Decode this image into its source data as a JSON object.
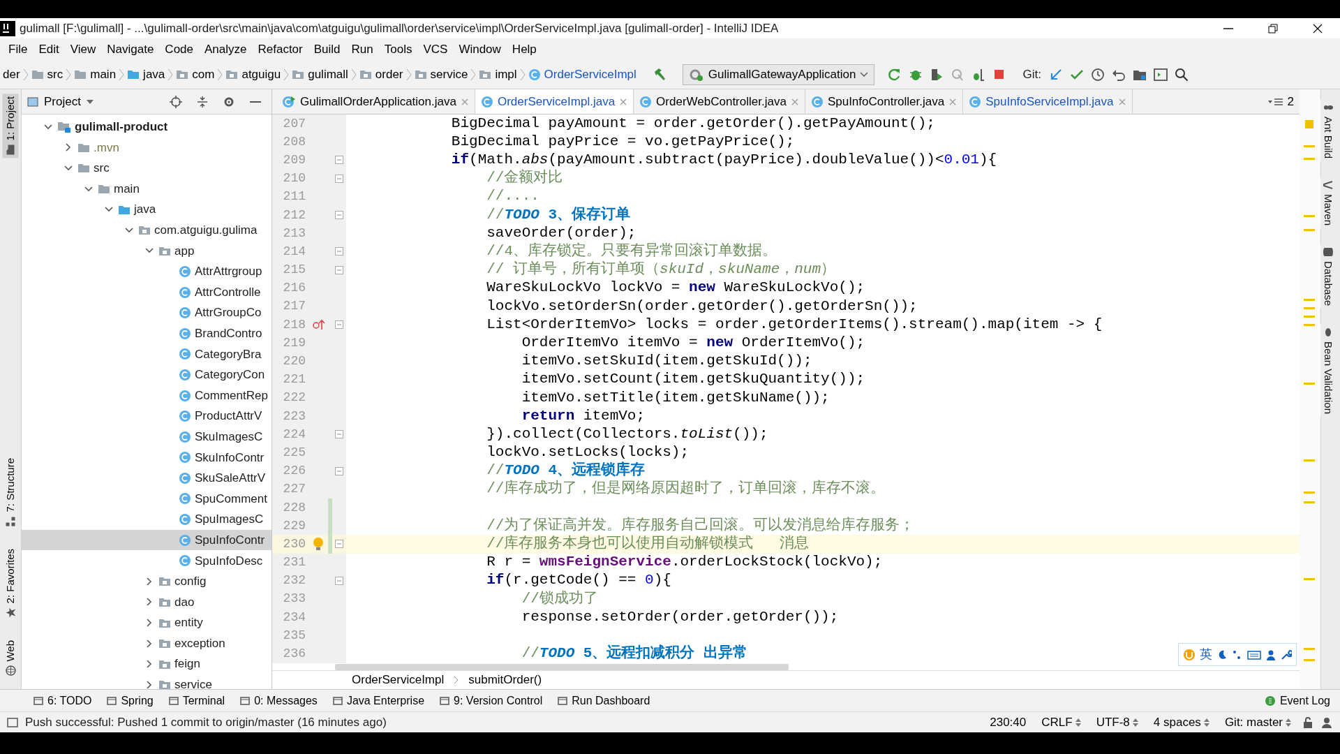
{
  "window": {
    "title": "gulimall [F:\\gulimall] - ...\\gulimall-order\\src\\main\\java\\com\\atguigu\\gulimall\\order\\service\\impl\\OrderServiceImpl.java [gulimall-order] - IntelliJ IDEA"
  },
  "menu": [
    "File",
    "Edit",
    "View",
    "Navigate",
    "Code",
    "Analyze",
    "Refactor",
    "Build",
    "Run",
    "Tools",
    "VCS",
    "Window",
    "Help"
  ],
  "nav_bar": {
    "crumbs": [
      {
        "label": "der",
        "kind": "text"
      },
      {
        "label": "src",
        "kind": "folder"
      },
      {
        "label": "main",
        "kind": "folder"
      },
      {
        "label": "java",
        "kind": "source"
      },
      {
        "label": "com",
        "kind": "package"
      },
      {
        "label": "atguigu",
        "kind": "package"
      },
      {
        "label": "gulimall",
        "kind": "package"
      },
      {
        "label": "order",
        "kind": "package"
      },
      {
        "label": "service",
        "kind": "package"
      },
      {
        "label": "impl",
        "kind": "package"
      },
      {
        "label": "OrderServiceImpl",
        "kind": "class"
      }
    ],
    "run_config": "GulimallGatewayApplication",
    "git_label": "Git:"
  },
  "left_strip": [
    "1: Project",
    "7: Structure",
    "2: Favorites",
    "Web"
  ],
  "project_panel": {
    "title": "Project",
    "tree": [
      {
        "label": "gulimall-product",
        "kind": "module",
        "expanded": true,
        "selected": false,
        "children": [
          {
            "label": ".mvn",
            "kind": "folder",
            "expanded": false,
            "selected": false
          },
          {
            "label": "src",
            "kind": "folder",
            "expanded": true,
            "selected": false,
            "children": [
              {
                "label": "main",
                "kind": "folder",
                "expanded": true,
                "selected": false,
                "children": [
                  {
                    "label": "java",
                    "kind": "source",
                    "expanded": true,
                    "selected": false,
                    "children": [
                      {
                        "label": "com.atguigu.gulima",
                        "kind": "package",
                        "expanded": true,
                        "selected": false,
                        "children": [
                          {
                            "label": "app",
                            "kind": "package",
                            "expanded": true,
                            "selected": false,
                            "children": [
                              {
                                "label": "AttrAttrgroup",
                                "kind": "class",
                                "selected": false
                              },
                              {
                                "label": "AttrControlle",
                                "kind": "class",
                                "selected": false
                              },
                              {
                                "label": "AttrGroupCo",
                                "kind": "class",
                                "selected": false
                              },
                              {
                                "label": "BrandContro",
                                "kind": "class",
                                "selected": false
                              },
                              {
                                "label": "CategoryBra",
                                "kind": "class",
                                "selected": false
                              },
                              {
                                "label": "CategoryCon",
                                "kind": "class",
                                "selected": false
                              },
                              {
                                "label": "CommentRep",
                                "kind": "class",
                                "selected": false
                              },
                              {
                                "label": "ProductAttrV",
                                "kind": "class",
                                "selected": false
                              },
                              {
                                "label": "SkuImagesC",
                                "kind": "class",
                                "selected": false
                              },
                              {
                                "label": "SkuInfoContr",
                                "kind": "class",
                                "selected": false
                              },
                              {
                                "label": "SkuSaleAttrV",
                                "kind": "class",
                                "selected": false
                              },
                              {
                                "label": "SpuComment",
                                "kind": "class",
                                "selected": false
                              },
                              {
                                "label": "SpuImagesC",
                                "kind": "class",
                                "selected": false
                              },
                              {
                                "label": "SpuInfoContr",
                                "kind": "class",
                                "selected": true
                              },
                              {
                                "label": "SpuInfoDesc",
                                "kind": "class",
                                "selected": false
                              }
                            ]
                          },
                          {
                            "label": "config",
                            "kind": "package",
                            "expanded": false,
                            "selected": false
                          },
                          {
                            "label": "dao",
                            "kind": "package",
                            "expanded": false,
                            "selected": false
                          },
                          {
                            "label": "entity",
                            "kind": "package",
                            "expanded": false,
                            "selected": false
                          },
                          {
                            "label": "exception",
                            "kind": "package",
                            "expanded": false,
                            "selected": false
                          },
                          {
                            "label": "feign",
                            "kind": "package",
                            "expanded": false,
                            "selected": false
                          },
                          {
                            "label": "service",
                            "kind": "package",
                            "expanded": false,
                            "selected": false
                          }
                        ]
                      }
                    ]
                  }
                ]
              }
            ]
          }
        ]
      }
    ]
  },
  "tabs": [
    {
      "label": "GulimallOrderApplication.java",
      "kind": "app",
      "selected": false,
      "modified": false
    },
    {
      "label": "OrderServiceImpl.java",
      "kind": "class",
      "selected": true,
      "modified": true
    },
    {
      "label": "OrderWebController.java",
      "kind": "class",
      "selected": false,
      "modified": false
    },
    {
      "label": "SpuInfoController.java",
      "kind": "class",
      "selected": false,
      "modified": false
    },
    {
      "label": "SpuInfoServiceImpl.java",
      "kind": "class",
      "selected": false,
      "modified": true
    }
  ],
  "tab_overflow": "2",
  "editor": {
    "lines": [
      {
        "number": "207",
        "fold": false,
        "changed": false,
        "current": false,
        "segments": [
          {
            "kind": "plain",
            "text": "        BigDecimal payAmount = order.getOrder().getPayAmount();"
          }
        ]
      },
      {
        "number": "208",
        "fold": false,
        "changed": false,
        "current": false,
        "segments": [
          {
            "kind": "plain",
            "text": "        BigDecimal payPrice = vo.getPayPrice();"
          }
        ]
      },
      {
        "number": "209",
        "fold": true,
        "changed": false,
        "current": false,
        "segments": [
          {
            "kind": "keyword",
            "text": "        if"
          },
          {
            "kind": "plain",
            "text": "(Math.*abs*(payAmount.subtract(payPrice).doubleValue())<"
          },
          {
            "kind": "number",
            "text": "0.01"
          },
          {
            "kind": "plain",
            "text": "){"
          }
        ]
      },
      {
        "number": "210",
        "fold": true,
        "changed": false,
        "current": false,
        "segments": [
          {
            "kind": "comment",
            "text": "            //金额对比"
          }
        ]
      },
      {
        "number": "211",
        "fold": false,
        "changed": false,
        "current": false,
        "segments": [
          {
            "kind": "comment",
            "text": "            //...."
          }
        ]
      },
      {
        "number": "212",
        "fold": true,
        "changed": false,
        "current": false,
        "segments": [
          {
            "kind": "comment",
            "text": "            //"
          },
          {
            "kind": "todo",
            "text": "*TODO* 3、保存订单"
          }
        ]
      },
      {
        "number": "213",
        "fold": false,
        "changed": false,
        "current": false,
        "segments": [
          {
            "kind": "plain",
            "text": "            saveOrder(order);"
          }
        ]
      },
      {
        "number": "214",
        "fold": true,
        "changed": false,
        "current": false,
        "segments": [
          {
            "kind": "comment",
            "text": "            //4、库存锁定。只要有异常回滚订单数据。"
          }
        ]
      },
      {
        "number": "215",
        "fold": true,
        "changed": false,
        "current": false,
        "segments": [
          {
            "kind": "comment",
            "text": "            // 订单号，所有订单项（*skuId*，*skuName*，*num*）"
          }
        ]
      },
      {
        "number": "216",
        "fold": false,
        "changed": false,
        "current": false,
        "segments": [
          {
            "kind": "plain",
            "text": "            WareSkuLockVo lockVo = "
          },
          {
            "kind": "keyword",
            "text": "new"
          },
          {
            "kind": "plain",
            "text": " WareSkuLockVo();"
          }
        ]
      },
      {
        "number": "217",
        "fold": false,
        "changed": false,
        "current": false,
        "segments": [
          {
            "kind": "plain",
            "text": "            lockVo.setOrderSn(order.getOrder().getOrderSn());"
          }
        ]
      },
      {
        "number": "218",
        "fold": true,
        "changed": false,
        "current": false,
        "kind": "override",
        "segments": [
          {
            "kind": "plain",
            "text": "            List<OrderItemVo> locks = order.getOrderItems().stream().map(item -> {"
          }
        ]
      },
      {
        "number": "219",
        "fold": false,
        "changed": false,
        "current": false,
        "segments": [
          {
            "kind": "plain",
            "text": "                OrderItemVo itemVo = "
          },
          {
            "kind": "keyword",
            "text": "new"
          },
          {
            "kind": "plain",
            "text": " OrderItemVo();"
          }
        ]
      },
      {
        "number": "220",
        "fold": false,
        "changed": false,
        "current": false,
        "segments": [
          {
            "kind": "plain",
            "text": "                itemVo.setSkuId(item.getSkuId());"
          }
        ]
      },
      {
        "number": "221",
        "fold": false,
        "changed": false,
        "current": false,
        "segments": [
          {
            "kind": "plain",
            "text": "                itemVo.setCount(item.getSkuQuantity());"
          }
        ]
      },
      {
        "number": "222",
        "fold": false,
        "changed": false,
        "current": false,
        "segments": [
          {
            "kind": "plain",
            "text": "                itemVo.setTitle(item.getSkuName());"
          }
        ]
      },
      {
        "number": "223",
        "fold": false,
        "changed": false,
        "current": false,
        "segments": [
          {
            "kind": "keyword",
            "text": "                return"
          },
          {
            "kind": "plain",
            "text": " itemVo;"
          }
        ]
      },
      {
        "number": "224",
        "fold": true,
        "changed": false,
        "current": false,
        "segments": [
          {
            "kind": "plain",
            "text": "            }).collect(Collectors.*toList*());"
          }
        ]
      },
      {
        "number": "225",
        "fold": false,
        "changed": false,
        "current": false,
        "segments": [
          {
            "kind": "plain",
            "text": "            lockVo.setLocks(locks);"
          }
        ]
      },
      {
        "number": "226",
        "fold": true,
        "changed": false,
        "current": false,
        "segments": [
          {
            "kind": "comment",
            "text": "            //"
          },
          {
            "kind": "todo",
            "text": "*TODO* 4、远程锁库存"
          }
        ]
      },
      {
        "number": "227",
        "fold": false,
        "changed": false,
        "current": false,
        "segments": [
          {
            "kind": "comment",
            "text": "            //库存成功了，但是网络原因超时了，订单回滚，库存不滚。"
          }
        ]
      },
      {
        "number": "228",
        "fold": false,
        "changed": true,
        "current": false
      },
      {
        "number": "229",
        "fold": false,
        "changed": true,
        "current": false,
        "segments": [
          {
            "kind": "comment",
            "text": "            //为了保证高并发。库存服务自己回滚。可以发消息给库存服务；"
          }
        ]
      },
      {
        "number": "230",
        "fold": true,
        "changed": true,
        "current": true,
        "kind": "intention",
        "segments": [
          {
            "kind": "comment",
            "text": "            //库存服务本身也可以使用自动解锁模式   消息"
          }
        ]
      },
      {
        "number": "231",
        "fold": false,
        "changed": false,
        "current": false,
        "segments": [
          {
            "kind": "plain",
            "text": "            R r = "
          },
          {
            "kind": "field",
            "text": "wmsFeignService"
          },
          {
            "kind": "plain",
            "text": ".orderLockStock(lockVo);"
          }
        ]
      },
      {
        "number": "232",
        "fold": true,
        "changed": false,
        "current": false,
        "segments": [
          {
            "kind": "keyword",
            "text": "            if"
          },
          {
            "kind": "plain",
            "text": "(r.getCode() == "
          },
          {
            "kind": "number",
            "text": "0"
          },
          {
            "kind": "plain",
            "text": "){"
          }
        ]
      },
      {
        "number": "233",
        "fold": false,
        "changed": false,
        "current": false,
        "segments": [
          {
            "kind": "comment",
            "text": "                //锁成功了"
          }
        ]
      },
      {
        "number": "234",
        "fold": false,
        "changed": false,
        "current": false,
        "segments": [
          {
            "kind": "plain",
            "text": "                response.setOrder(order.getOrder());"
          }
        ]
      },
      {
        "number": "235",
        "fold": false,
        "changed": false,
        "current": false
      },
      {
        "number": "236",
        "fold": false,
        "changed": false,
        "current": false,
        "segments": [
          {
            "kind": "comment",
            "text": "                //"
          },
          {
            "kind": "todo",
            "text": "*TODO* 5、远程扣减积分 出异常"
          }
        ]
      }
    ],
    "breadcrumb": [
      "OrderServiceImpl",
      "submitOrder()"
    ]
  },
  "right_strip": [
    "Ant Build",
    "Maven",
    "Database",
    "Bean Validation"
  ],
  "ime_bar": {
    "label": "英"
  },
  "tool_windows": {
    "items": [
      "6: TODO",
      "Spring",
      "Terminal",
      "0: Messages",
      "Java Enterprise",
      "9: Version Control",
      "Run Dashboard"
    ],
    "right": "Event Log"
  },
  "status_bar": {
    "message": "Push successful: Pushed 1 commit to origin/master (16 minutes ago)",
    "items": [
      {
        "label": "230:40",
        "dropdown": false
      },
      {
        "label": "CRLF",
        "dropdown": true
      },
      {
        "label": "UTF-8",
        "dropdown": true
      },
      {
        "label": "4 spaces",
        "dropdown": true
      },
      {
        "label": "Git: master",
        "dropdown": true
      }
    ]
  }
}
